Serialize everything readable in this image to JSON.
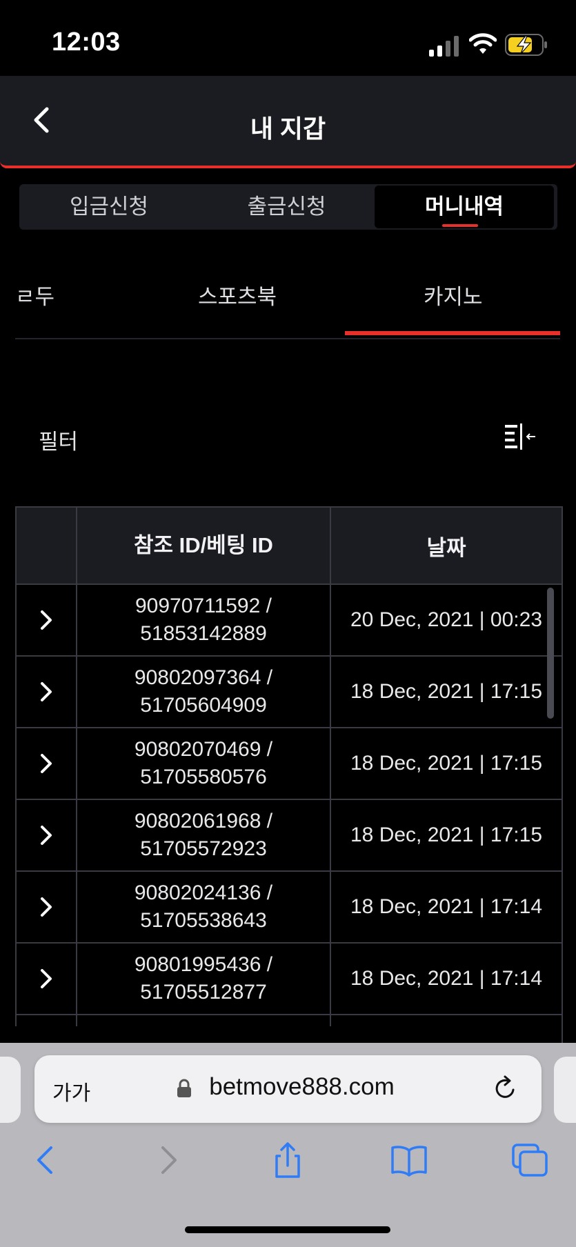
{
  "status_bar": {
    "time": "12:03"
  },
  "header": {
    "title": "내 지갑"
  },
  "segments": [
    {
      "label": "입금신청",
      "active": false
    },
    {
      "label": "출금신청",
      "active": false
    },
    {
      "label": "머니내역",
      "active": true
    }
  ],
  "subtabs": [
    {
      "label": "ㄹ두",
      "active": false
    },
    {
      "label": "스포츠북",
      "active": false
    },
    {
      "label": "카지노",
      "active": true
    }
  ],
  "filter": {
    "label": "필터"
  },
  "table": {
    "headers": [
      "",
      "참조 ID/베팅 ID",
      "날짜"
    ],
    "rows": [
      {
        "ref": "90970711592 /",
        "bet": "51853142889",
        "date": "20 Dec, 2021 | 00:23"
      },
      {
        "ref": "90802097364 /",
        "bet": "51705604909",
        "date": "18 Dec, 2021 | 17:15"
      },
      {
        "ref": "90802070469 /",
        "bet": "51705580576",
        "date": "18 Dec, 2021 | 17:15"
      },
      {
        "ref": "90802061968 /",
        "bet": "51705572923",
        "date": "18 Dec, 2021 | 17:15"
      },
      {
        "ref": "90802024136 /",
        "bet": "51705538643",
        "date": "18 Dec, 2021 | 17:14"
      },
      {
        "ref": "90801995436 /",
        "bet": "51705512877",
        "date": "18 Dec, 2021 | 17:14"
      }
    ]
  },
  "browser": {
    "text_size_label": "가가",
    "url": "betmove888.com"
  },
  "colors": {
    "accent": "#e8302a",
    "panel": "#1b1c22",
    "background": "#000000",
    "ios_blue": "#2f7cf6"
  }
}
